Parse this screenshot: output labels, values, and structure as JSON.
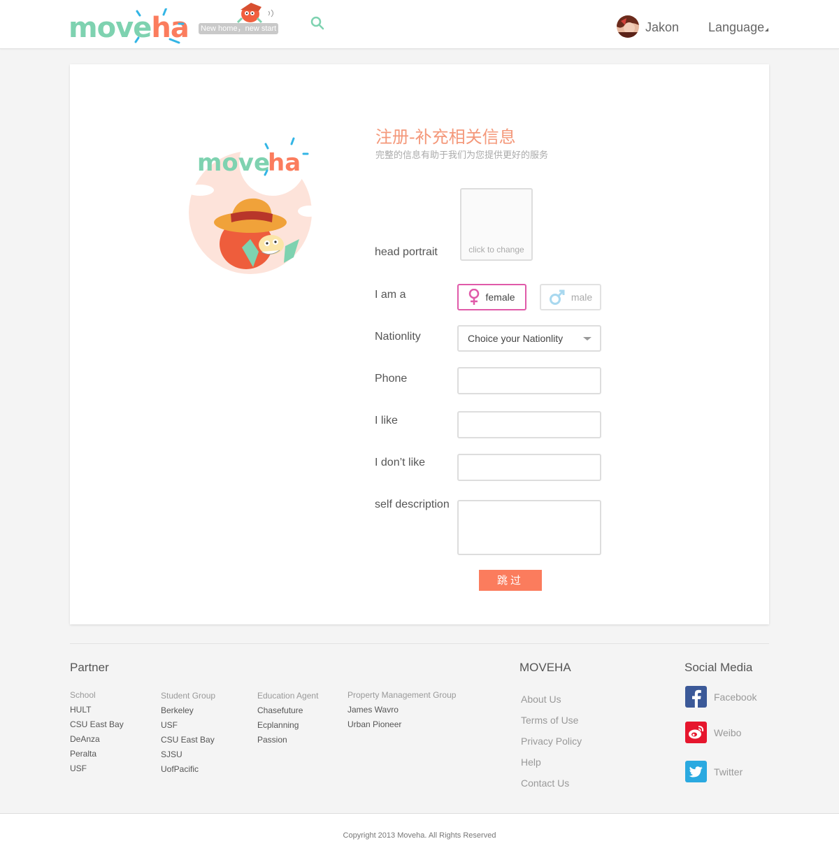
{
  "header": {
    "logo_left": "move",
    "logo_right": "ha",
    "slogan": "New home，new start",
    "user_name": "Jakon",
    "language_label": "Language",
    "icons": [
      "search-icon",
      "user-avatar",
      "caret-icon"
    ]
  },
  "colors": {
    "brand_green": "#7ed2b0",
    "brand_orange": "#fb7c5d",
    "brand_blue": "#33b5e5",
    "title_orange": "#f4987a",
    "female_pink": "#e05aa9",
    "male_blue": "#a8d8ef"
  },
  "form": {
    "title": "注册-补充相关信息",
    "subtitle": "完整的信息有助于我们为您提供更好的服务",
    "head_portrait_label": "head portrait",
    "portrait_hint": "click to change",
    "gender_label": "I am a",
    "female_label": "female",
    "male_label": "male",
    "gender_selected": "female",
    "nationality_label": "Nationlity",
    "nationality_placeholder": "Choice your Nationlity",
    "phone_label": "Phone",
    "phone_value": "",
    "like_label": "I like",
    "like_value": "",
    "dislike_label": "I don’t like",
    "dislike_value": "",
    "description_label": "self  description",
    "description_value": "",
    "skip_button": "跳过"
  },
  "footer": {
    "partner_heading": "Partner",
    "partner_columns": [
      {
        "heading": "School",
        "items": [
          "HULT",
          "CSU East Bay",
          "DeAnza",
          "Peralta",
          "USF"
        ]
      },
      {
        "heading": "Student Group",
        "items": [
          "Berkeley",
          "USF",
          "CSU East Bay",
          "SJSU",
          "UofPacific"
        ]
      },
      {
        "heading": "Education Agent",
        "items": [
          "Chasefuture",
          "Ecplanning",
          "Passion"
        ]
      },
      {
        "heading": "Property Management Group",
        "items": [
          "James Wavro",
          "Urban Pioneer"
        ]
      }
    ],
    "moveha_heading": "MOVEHA",
    "moveha_links": [
      "About Us",
      "Terms of Use",
      "Privacy Policy",
      "Help",
      "Contact Us"
    ],
    "social_heading": "Social Media",
    "social_links": [
      {
        "label": "Facebook",
        "icon": "facebook-icon",
        "color": "#3b5998"
      },
      {
        "label": "Weibo",
        "icon": "weibo-icon",
        "color": "#e6162d"
      },
      {
        "label": "Twitter",
        "icon": "twitter-icon",
        "color": "#2aa9e0"
      }
    ],
    "copyright": "Copyright 2013 Moveha.  All Rights Reserved"
  }
}
